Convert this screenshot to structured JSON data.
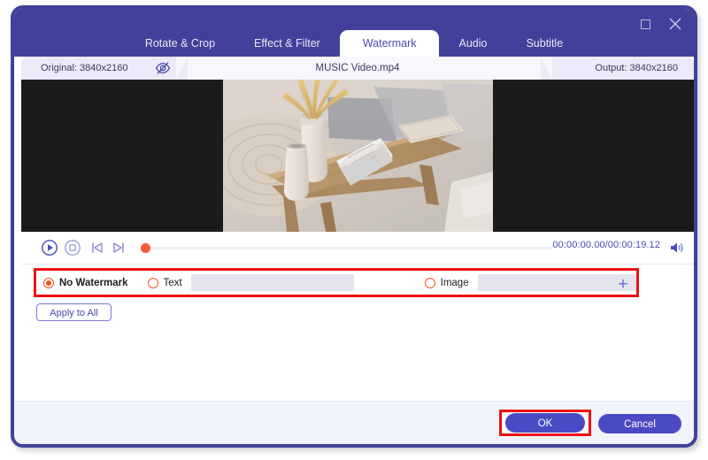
{
  "window": {
    "controls": [
      {
        "name": "maximize",
        "glyph": "square"
      },
      {
        "name": "close",
        "glyph": "x"
      }
    ]
  },
  "tabs": [
    {
      "label": "Rotate & Crop",
      "active": false
    },
    {
      "label": "Effect & Filter",
      "active": false
    },
    {
      "label": "Watermark",
      "active": true
    },
    {
      "label": "Audio",
      "active": false
    },
    {
      "label": "Subtitle",
      "active": false
    }
  ],
  "info_bar": {
    "original_label": "Original: 3840x2160",
    "file_name": "MUSIC Video.mp4",
    "output_label": "Output: 3840x2160",
    "preview_toggle_icon": "eye-slash-icon"
  },
  "player": {
    "play_icon": "play-circle-icon",
    "stop_icon": "stop-circle-icon",
    "prev_icon": "previous-frame-icon",
    "next_icon": "next-frame-icon",
    "volume_icon": "volume-icon",
    "timecode": "00:00:00.00/00:00:19.12",
    "current_time": "00:00:00.00",
    "duration": "00:00:19.12",
    "progress_percent": 0
  },
  "watermark": {
    "options": [
      {
        "id": "none",
        "label": "No Watermark",
        "selected": true
      },
      {
        "id": "text",
        "label": "Text",
        "selected": false
      },
      {
        "id": "image",
        "label": "Image",
        "selected": false
      }
    ],
    "text_value": "",
    "text_placeholder": "",
    "image_value": "",
    "image_placeholder": "",
    "add_image_icon": "plus-icon",
    "highlight_color": "#ee1111"
  },
  "apply_to_all_label": "Apply to All",
  "footer": {
    "ok_label": "OK",
    "cancel_label": "Cancel",
    "highlight_color": "#ee1111"
  },
  "theme": {
    "accent": "#41419b",
    "button": "#4a4ac4",
    "radio": "#f4551d",
    "seek_handle": "#fa5a32"
  }
}
